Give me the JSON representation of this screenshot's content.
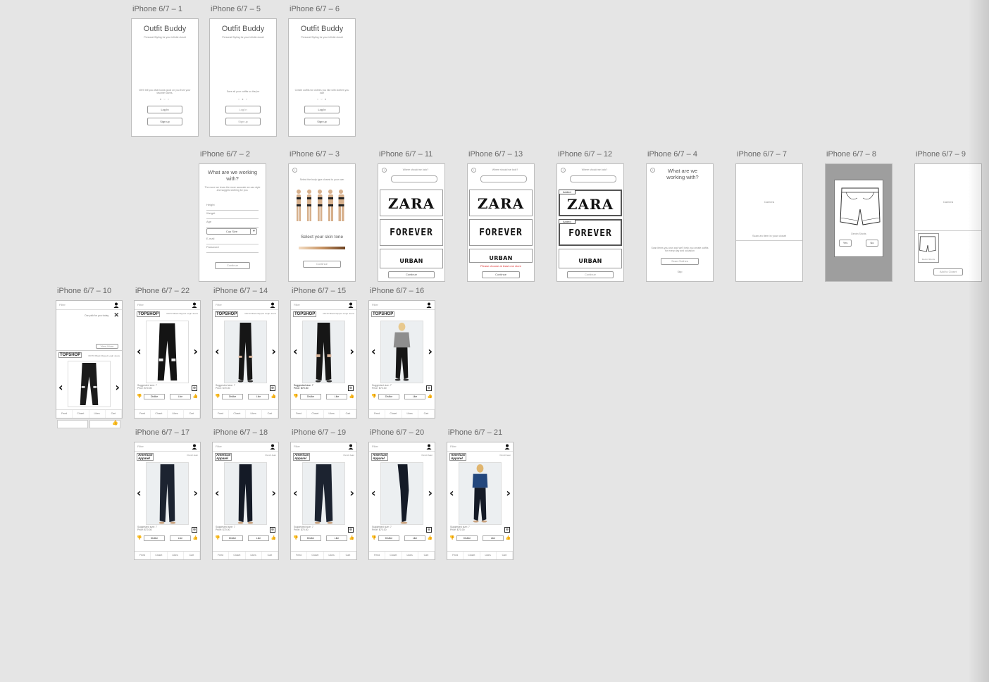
{
  "labels": {
    "a1": "iPhone 6/7 – 1",
    "a5": "iPhone 6/7 – 5",
    "a6": "iPhone 6/7 – 6",
    "a2": "iPhone 6/7 – 2",
    "a3": "iPhone 6/7 – 3",
    "a11": "iPhone 6/7 – 11",
    "a13": "iPhone 6/7 – 13",
    "a12": "iPhone 6/7 – 12",
    "a4": "iPhone 6/7 – 4",
    "a7": "iPhone 6/7 – 7",
    "a8": "iPhone 6/7 – 8",
    "a9": "iPhone 6/7 – 9",
    "a10": "iPhone 6/7 – 10",
    "a22": "iPhone 6/7 – 22",
    "a14": "iPhone 6/7 – 14",
    "a15": "iPhone 6/7 – 15",
    "a16": "iPhone 6/7 – 16",
    "a17": "iPhone 6/7 – 17",
    "a18": "iPhone 6/7 – 18",
    "a19": "iPhone 6/7 – 19",
    "a20": "iPhone 6/7 – 20",
    "a21": "iPhone 6/7 – 21"
  },
  "onboarding": {
    "title": "Outfit Buddy",
    "subtitle": "Personal Styling for your infinite closet",
    "login": "Log In",
    "signup": "Sign up",
    "caption1": "We'll tell you what looks good on you from your favorite stores.",
    "caption5": "Save all your outfits so they're",
    "caption6": "Create outfits for clothes you like with clothes you own"
  },
  "profile": {
    "title": "What are we working with?",
    "desc": "The more we know the more accurate we can style and suggest clothing for you.",
    "fields": [
      "Height",
      "Weight",
      "Age",
      "Cup Size",
      "E-mail",
      "Password"
    ],
    "continue": "Continue"
  },
  "skin": {
    "hint": "Select the body type closest to your own",
    "label": "Select your skin tone",
    "continue": "Continue"
  },
  "stores": {
    "question": "Where should we look?",
    "zara": "ZARA",
    "f21": "FOREVER 21",
    "uo": "URBAN OUTFITTERS",
    "added": "Added",
    "error": "Please choose at least one store",
    "continue": "Continue"
  },
  "closet_intro": {
    "title": "What are we working with?",
    "desc": "Scan items you own and we'll help you create outfits for every day and occasion",
    "scan": "Scan Clothes",
    "skip": "Skip"
  },
  "camera": {
    "label": "Camera",
    "hint": "Scan an item in your closet",
    "item": "Denim Shorts",
    "yes": "Yes",
    "no": "No",
    "add": "Add to Closet"
  },
  "feed": {
    "filter": "Filter",
    "picks": "Our pick for you today",
    "view_more": "View More",
    "topshop": "TOPSHOP",
    "topshop_item": "MOTO Black Ripped Leigh Jeans",
    "aa": "American Apparel",
    "aa_item": "Pencil Jean",
    "size": "Suggested size: 7",
    "price": "Price: $70.00",
    "dislike": "Dislike",
    "like": "Like",
    "tabs": [
      "Feed",
      "Closet",
      "Likes",
      "Cart"
    ]
  }
}
